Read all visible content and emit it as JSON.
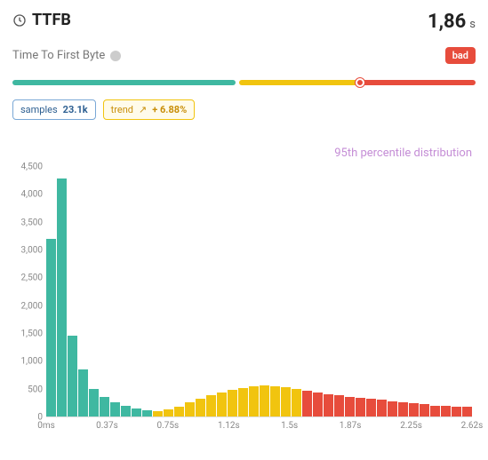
{
  "header": {
    "title": "TTFB",
    "value": "1,86",
    "unit": "s"
  },
  "subtitle": "Time To First Byte",
  "rating": {
    "label": "bad"
  },
  "distribution": {
    "good_pct": 49,
    "mid_pct": 26,
    "bad_pct": 25,
    "marker_pct": 75
  },
  "chips": {
    "samples": {
      "label": "samples",
      "value": "23.1k"
    },
    "trend": {
      "label": "trend",
      "arrow": "↗",
      "value": "+ 6.88%"
    }
  },
  "chart_title": "95th percentile distribution",
  "chart_data": {
    "type": "bar",
    "title": "95th percentile distribution",
    "xlabel": "",
    "ylabel": "",
    "ylim": [
      0,
      4500
    ],
    "y_ticks": [
      0,
      500,
      1000,
      1500,
      2000,
      2500,
      3000,
      3500,
      4000,
      4500
    ],
    "x_ticks": [
      "0ms",
      "0.37s",
      "0.75s",
      "1.12s",
      "1.5s",
      "1.87s",
      "2.25s",
      "2.62s"
    ],
    "thresholds": {
      "good_max_s": 0.75,
      "mid_max_s": 1.8
    },
    "categories_s": [
      0.0,
      0.075,
      0.15,
      0.225,
      0.3,
      0.375,
      0.45,
      0.525,
      0.6,
      0.675,
      0.75,
      0.825,
      0.9,
      0.975,
      1.05,
      1.125,
      1.2,
      1.275,
      1.35,
      1.425,
      1.5,
      1.575,
      1.65,
      1.725,
      1.8,
      1.875,
      1.95,
      2.025,
      2.1,
      2.175,
      2.25,
      2.325,
      2.4,
      2.475,
      2.55,
      2.625,
      2.7,
      2.775,
      2.85,
      2.925
    ],
    "values": [
      3200,
      4300,
      1450,
      850,
      500,
      350,
      250,
      200,
      150,
      120,
      100,
      130,
      180,
      250,
      320,
      380,
      430,
      480,
      520,
      540,
      560,
      550,
      530,
      500,
      460,
      430,
      400,
      380,
      360,
      340,
      320,
      300,
      280,
      260,
      240,
      220,
      200,
      190,
      180,
      170
    ]
  }
}
